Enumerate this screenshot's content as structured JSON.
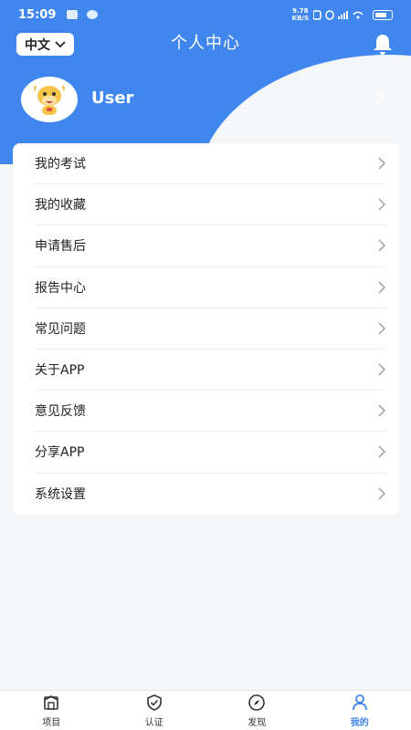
{
  "status_bar": {
    "time": "15:09",
    "net_speed_value": "9.78",
    "net_speed_unit": "KB/S"
  },
  "header": {
    "language": "中文",
    "title": "个人中心",
    "username": "User"
  },
  "menu": [
    {
      "label": "我的考试"
    },
    {
      "label": "我的收藏"
    },
    {
      "label": "申请售后"
    },
    {
      "label": "报告中心"
    },
    {
      "label": "常见问题"
    },
    {
      "label": "关于APP"
    },
    {
      "label": "意见反馈"
    },
    {
      "label": "分享APP"
    },
    {
      "label": "系统设置"
    }
  ],
  "tabbar": [
    {
      "label": "项目",
      "icon": "project-icon"
    },
    {
      "label": "认证",
      "icon": "shield-check-icon"
    },
    {
      "label": "发现",
      "icon": "compass-icon"
    },
    {
      "label": "我的",
      "icon": "person-icon",
      "active": true
    }
  ],
  "colors": {
    "primary": "#3f86ef",
    "background": "#f5f6f8"
  }
}
